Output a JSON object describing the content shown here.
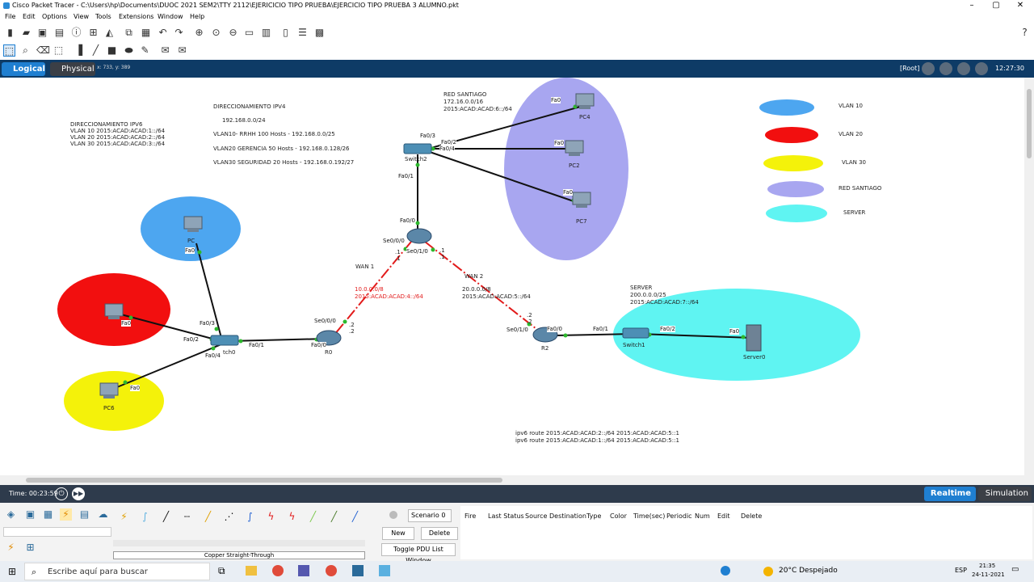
{
  "window": {
    "title": "Cisco Packet Tracer - C:\\Users\\hp\\Documents\\DUOC 2021 SEM2\\TTY 2112\\EJERICICIO TIPO PRUEBA\\EJERCICIO TIPO PRUEBA 3 ALUMNO.pkt"
  },
  "menu": [
    "File",
    "Edit",
    "Options",
    "View",
    "Tools",
    "Extensions",
    "Window",
    "Help"
  ],
  "view": {
    "logical": "Logical",
    "physical": "Physical",
    "coords": "x: 733, y: 389",
    "root": "[Root]",
    "clock": "12:27:30"
  },
  "annotations": {
    "ipv6_title": "DIRECCIONAMIENTO IPV6",
    "ipv6_lines": [
      "VLAN 10 2015:ACAD:ACAD:1::/64",
      "VLAN 20 2015:ACAD:ACAD:2::/64",
      "VLAN 30 2015:ACAD:ACAD:3::/64"
    ],
    "ipv4_title": "DIRECCIONAMIENTO IPV4",
    "ipv4_net": "192.168.0.0/24",
    "ipv4_lines": [
      "VLAN10- RRHH  100 Hosts - 192.168.0.0/25",
      "VLAN20 GERENCIA  50 Hosts - 192.168.0.128/26",
      "VLAN30 SEGURIDAD 20 Hosts - 192.168.0.192/27"
    ],
    "red_santiago": [
      "RED SANTIAGO",
      "172.16.0.0/16",
      "2015:ACAD:ACAD:6::/64"
    ],
    "wan1_label": "WAN 1",
    "wan1_net": [
      "10.0.0.0/8",
      "2015:ACAD:ACAD:4::/64"
    ],
    "wan2_label": "WAN 2",
    "wan2_net": [
      "20.0.0.0/8",
      "2015:ACAD:ACAD:5::/64"
    ],
    "server_net": [
      "SERVER",
      "200.0.0.0/25",
      "2015:ACAD:ACAD:7::/64"
    ],
    "routes": [
      "ipv6 route 2015:ACAD:ACAD:2::/64 2015:ACAD:ACAD:5::1",
      "ipv6 route 2015:ACAD:ACAD:1::/64 2015:ACAD:ACAD:5::1"
    ]
  },
  "legend": [
    {
      "label": "VLAN 10",
      "color": "#4da6f0"
    },
    {
      "label": "VLAN 20",
      "color": "#f20f0f"
    },
    {
      "label": "VLAN 30",
      "color": "#f4f20a"
    },
    {
      "label": "RED SANTIAGO",
      "color": "#a8a6f0"
    },
    {
      "label": "SERVER",
      "color": "#5ff4f2"
    }
  ],
  "devices": {
    "pc4": "PC4",
    "pc2": "PC2",
    "pc7": "PC7",
    "switch2": "Switch2",
    "router_top": "",
    "pc_vlan10": "PC",
    "pc_vlan20": "",
    "pc6": "PC6",
    "switch0": "tch0",
    "r0": "R0",
    "r2": "R2",
    "switch1": "Switch1",
    "server0": "Server0"
  },
  "ports": {
    "fa0_pc4": "Fa0",
    "fa0_pc2": "Fa0",
    "fa0_pc7": "Fa0",
    "fa03_s2": "Fa0/3",
    "fa02_s2": "Fa0/2",
    "fa04_s2": "Fa0/4",
    "fa01_s2": "Fa0/1",
    "fa00_rt": "Fa0/0",
    "se000_rt": "Se0/0/0",
    "se010_rt": "Se0/1/0",
    "fa0_pc10": "Fa0",
    "fa0_pc20": "Fa0",
    "fa0_pc6": "Fa0",
    "fa03_s0": "Fa0/3",
    "fa02_s0": "Fa0/2",
    "fa04_s0": "Fa0/4",
    "fa01_s0": "Fa0/1",
    "fa00_r0": "Fa0/0",
    "se000_r0": "Se0/0/0",
    "se010_r2": "Se0/1/0",
    "fa00_r2": "Fa0/0",
    "fa01_sw1": "Fa0/1",
    "fa02_sw1": "Fa0/2",
    "fa0_srv": "Fa0",
    "w1_a": ".1",
    "w1_b": ".1",
    "w1_c": ".2",
    "w1_d": ".2",
    "w2_a": ".1",
    "w2_b": ".1",
    "w2_c": ".2",
    "w2_d": ".2"
  },
  "time": "Time: 00:23:59",
  "realtime": "Realtime",
  "simulation": "Simulation",
  "pdu": {
    "scenario": "Scenario 0",
    "new": "New",
    "delete": "Delete",
    "toggle": "Toggle PDU List Window",
    "columns": [
      "Fire",
      "Last Status",
      "Source",
      "Destination",
      "Type",
      "Color",
      "Time(sec)",
      "Periodic",
      "Num",
      "Edit",
      "Delete"
    ]
  },
  "cable_label": "Copper Straight-Through",
  "taskbar": {
    "search": "Escribe aquí para buscar",
    "weather": "20°C Despejado",
    "lang": "ESP",
    "time": "21:35",
    "date": "24-11-2021"
  }
}
